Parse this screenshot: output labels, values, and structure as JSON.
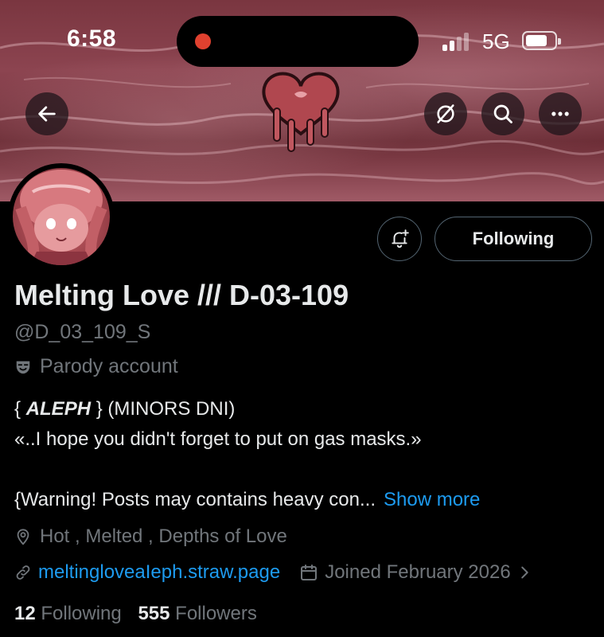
{
  "status_bar": {
    "time": "6:58",
    "network": "5G"
  },
  "header": {
    "back_icon": "arrow-left-icon",
    "grok_icon": "slash-circle-icon",
    "search_icon": "search-icon",
    "more_icon": "more-dots-icon"
  },
  "profile": {
    "display_name": "Melting Love /// D-03-109",
    "handle": "@D_03_109_S",
    "account_label": "Parody account",
    "bio": {
      "line1_prefix": "{ ",
      "line1_bold": "ALEPH",
      "line1_suffix": " } (MINORS DNI)",
      "line2": "«..I hope you didn't forget to put on gas masks.»",
      "line3": "{Warning! Posts may contains heavy con...",
      "show_more": "Show more"
    },
    "location": "Hot , Melted , Depths of Love",
    "website": "meltingloveaIeph.straw.page",
    "joined": "Joined February 2026",
    "following_count": "12",
    "following_label": "Following",
    "followers_count": "555",
    "followers_label": "Followers"
  },
  "actions": {
    "notify_icon": "bell-plus-icon",
    "follow_state_label": "Following"
  },
  "colors": {
    "background": "#000000",
    "text": "#e7e9ea",
    "muted": "#71767b",
    "link": "#1d9bf0",
    "border": "#536471",
    "banner": "#7a3640"
  }
}
